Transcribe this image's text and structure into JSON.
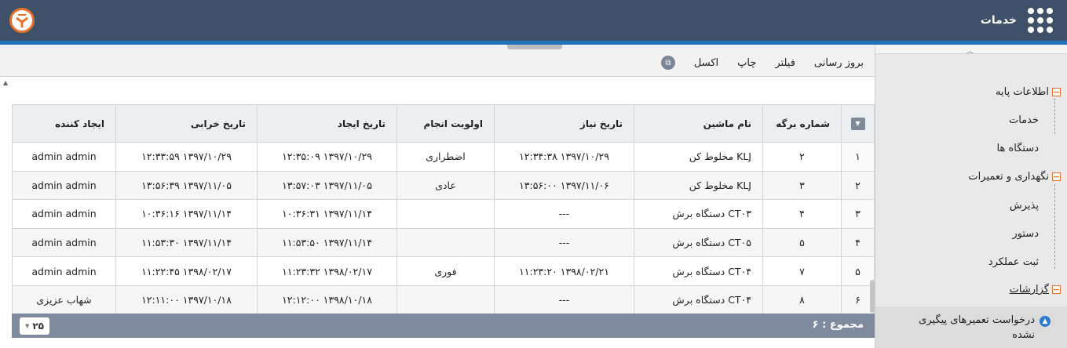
{
  "header": {
    "title": "خدمات"
  },
  "sidebar": {
    "groups": [
      {
        "label": "اطلاعات پایه",
        "items": [
          "خدمات",
          "دستگاه ها"
        ]
      },
      {
        "label": "نگهداری و تعمیرات",
        "items": [
          "پذیرش",
          "دستور",
          "ثبت عملکرد"
        ]
      },
      {
        "label": "گزارشات",
        "items": []
      }
    ],
    "active_item": "درخواست تعمیرهای پیگیری نشده"
  },
  "toolbar": {
    "refresh": "بروز رسانی",
    "filter": "فیلتر",
    "print": "چاپ",
    "excel": "اکسل"
  },
  "table": {
    "columns": [
      "شماره برگه",
      "نام ماشین",
      "تاریخ نیاز",
      "اولویت انجام",
      "تاریخ ایجاد",
      "تاریخ خرابی",
      "ایجاد کننده"
    ],
    "rows": [
      {
        "n": "۱",
        "sheet": "۲",
        "machine": "KLJ مخلوط کن",
        "need": "۱۳۹۷/۱۰/۲۹ ۱۲:۳۴:۳۸",
        "priority": "اضطراری",
        "created": "۱۳۹۷/۱۰/۲۹ ۱۲:۳۵:۰۹",
        "failure": "۱۳۹۷/۱۰/۲۹ ۱۲:۳۳:۵۹",
        "creator": "admin admin"
      },
      {
        "n": "۲",
        "sheet": "۳",
        "machine": "KLJ مخلوط کن",
        "need": "۱۳۹۷/۱۱/۰۶ ۱۳:۵۶:۰۰",
        "priority": "عادی",
        "created": "۱۳۹۷/۱۱/۰۵ ۱۳:۵۷:۰۳",
        "failure": "۱۳۹۷/۱۱/۰۵ ۱۳:۵۶:۳۹",
        "creator": "admin admin"
      },
      {
        "n": "۳",
        "sheet": "۴",
        "machine": "CT۰۳ دستگاه برش",
        "need": "---",
        "priority": "",
        "created": "۱۳۹۷/۱۱/۱۴ ۱۰:۳۶:۳۱",
        "failure": "۱۳۹۷/۱۱/۱۴ ۱۰:۳۶:۱۶",
        "creator": "admin admin"
      },
      {
        "n": "۴",
        "sheet": "۵",
        "machine": "CT۰۵ دستگاه برش",
        "need": "---",
        "priority": "",
        "created": "۱۳۹۷/۱۱/۱۴ ۱۱:۵۳:۵۰",
        "failure": "۱۳۹۷/۱۱/۱۴ ۱۱:۵۳:۳۰",
        "creator": "admin admin"
      },
      {
        "n": "۵",
        "sheet": "۷",
        "machine": "CT۰۴ دستگاه برش",
        "need": "۱۳۹۸/۰۲/۲۱ ۱۱:۲۳:۲۰",
        "priority": "فوری",
        "created": "۱۳۹۸/۰۲/۱۷ ۱۱:۲۳:۳۲",
        "failure": "۱۳۹۸/۰۲/۱۷ ۱۱:۲۲:۴۵",
        "creator": "admin admin"
      },
      {
        "n": "۶",
        "sheet": "۸",
        "machine": "CT۰۴ دستگاه برش",
        "need": "---",
        "priority": "",
        "created": "۱۳۹۸/۱۰/۱۸ ۱۲:۱۲:۰۰",
        "failure": "۱۳۹۷/۱۰/۱۸ ۱۲:۱۱:۰۰",
        "creator": "شهاب عزیزی"
      }
    ]
  },
  "footer": {
    "total_label": "مجموع :",
    "total_value": "۶",
    "page_size": "۲۵"
  },
  "colors": {
    "topbar": "#3f5169",
    "accent": "#1f6fbf",
    "orange": "#e8702a",
    "footer": "#7f8a9f"
  }
}
